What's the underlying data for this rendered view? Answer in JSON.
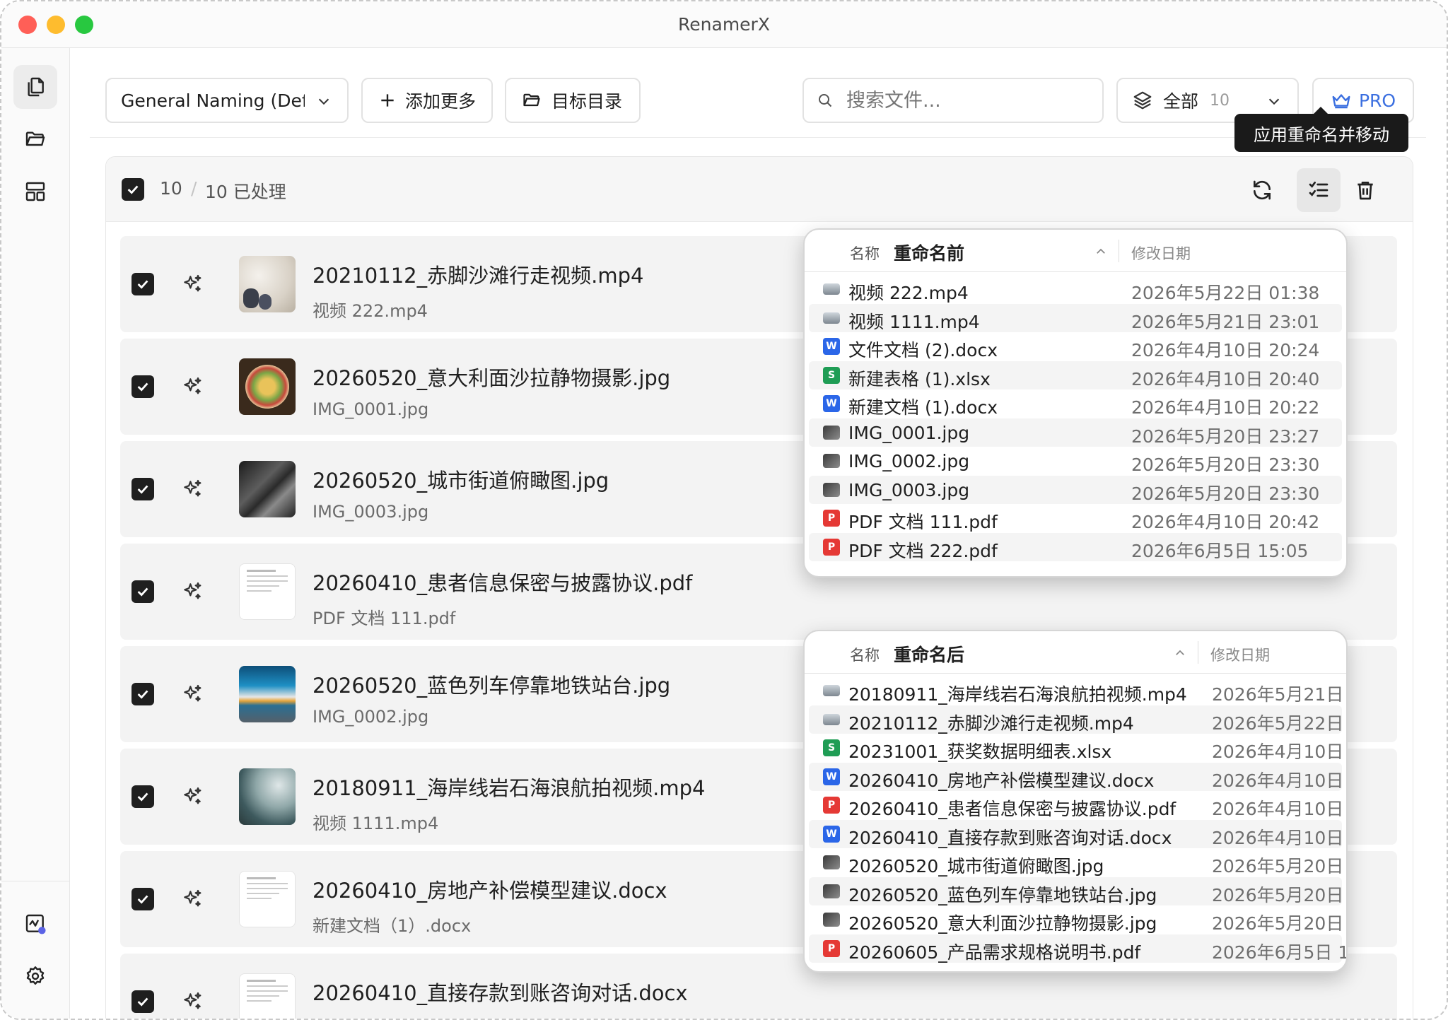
{
  "window": {
    "title": "RenamerX"
  },
  "colors": {
    "close": "#ff5f57",
    "minimize": "#febc2e",
    "maximize": "#28c840",
    "pro": "#3b6fe0",
    "word": "#2b66e8",
    "excel": "#1f9d55",
    "pdf": "#e53935"
  },
  "sidebar": {
    "items": [
      {
        "name": "copy-files-icon",
        "active": true
      },
      {
        "name": "folder-open-icon",
        "active": false
      },
      {
        "name": "layout-icon",
        "active": false
      }
    ],
    "bottom": [
      {
        "name": "activity-icon"
      },
      {
        "name": "settings-gear-icon"
      }
    ]
  },
  "toolbar": {
    "preset": "General Naming (Defa",
    "add_more": "添加更多",
    "target_dir": "目标目录",
    "search_placeholder": "搜索文件...",
    "filter_label": "全部",
    "filter_count": "10",
    "pro_label": "PRO"
  },
  "tooltip": "应用重命名并移动",
  "list": {
    "selected": "10",
    "separator": "/",
    "processed": "10 已处理",
    "rows": [
      {
        "name": "20210112_赤脚沙滩行走视频.mp4",
        "original": "视频 222.mp4",
        "thumb": "sand"
      },
      {
        "name": "20260520_意大利面沙拉静物摄影.jpg",
        "original": "IMG_0001.jpg",
        "thumb": "salad"
      },
      {
        "name": "20260520_城市街道俯瞰图.jpg",
        "original": "IMG_0003.jpg",
        "thumb": "city"
      },
      {
        "name": "20260410_患者信息保密与披露协议.pdf",
        "original": "PDF 文档 111.pdf",
        "thumb": "doc"
      },
      {
        "name": "20260520_蓝色列车停靠地铁站台.jpg",
        "original": "IMG_0002.jpg",
        "thumb": "train"
      },
      {
        "name": "20180911_海岸线岩石海浪航拍视频.mp4",
        "original": "视频 1111.mp4",
        "thumb": "coast"
      },
      {
        "name": "20260410_房地产补偿模型建议.docx",
        "original": "新建文档（1）.docx",
        "thumb": "doc"
      },
      {
        "name": "20260410_直接存款到账咨询对话.docx",
        "original": "",
        "thumb": "doc"
      }
    ]
  },
  "before_popup": {
    "col_name": "名称",
    "title": "重命名前",
    "col_date": "修改日期",
    "rows": [
      {
        "name": "视频 222.mp4",
        "date": "2026年5月22日 01:38",
        "type": "video"
      },
      {
        "name": "视频 1111.mp4",
        "date": "2026年5月21日 23:01",
        "type": "video"
      },
      {
        "name": "文件文档 (2).docx",
        "date": "2026年4月10日 20:24",
        "type": "word"
      },
      {
        "name": "新建表格 (1).xlsx",
        "date": "2026年4月10日 20:40",
        "type": "excel"
      },
      {
        "name": "新建文档 (1).docx",
        "date": "2026年4月10日 20:22",
        "type": "word"
      },
      {
        "name": "IMG_0001.jpg",
        "date": "2026年5月20日 23:27",
        "type": "image"
      },
      {
        "name": "IMG_0002.jpg",
        "date": "2026年5月20日 23:30",
        "type": "image"
      },
      {
        "name": "IMG_0003.jpg",
        "date": "2026年5月20日 23:30",
        "type": "image"
      },
      {
        "name": "PDF 文档 111.pdf",
        "date": "2026年4月10日 20:42",
        "type": "pdf"
      },
      {
        "name": "PDF 文档 222.pdf",
        "date": "2026年6月5日 15:05",
        "type": "pdf"
      }
    ]
  },
  "after_popup": {
    "col_name": "名称",
    "title": "重命名后",
    "col_date": "修改日期",
    "rows": [
      {
        "name": "20180911_海岸线岩石海浪航拍视频.mp4",
        "date": "2026年5月21日",
        "type": "video"
      },
      {
        "name": "20210112_赤脚沙滩行走视频.mp4",
        "date": "2026年5月22日",
        "type": "video"
      },
      {
        "name": "20231001_获奖数据明细表.xlsx",
        "date": "2026年4月10日",
        "type": "excel"
      },
      {
        "name": "20260410_房地产补偿模型建议.docx",
        "date": "2026年4月10日",
        "type": "word"
      },
      {
        "name": "20260410_患者信息保密与披露协议.pdf",
        "date": "2026年4月10日",
        "type": "pdf"
      },
      {
        "name": "20260410_直接存款到账咨询对话.docx",
        "date": "2026年4月10日",
        "type": "word"
      },
      {
        "name": "20260520_城市街道俯瞰图.jpg",
        "date": "2026年5月20日",
        "type": "image"
      },
      {
        "name": "20260520_蓝色列车停靠地铁站台.jpg",
        "date": "2026年5月20日",
        "type": "image"
      },
      {
        "name": "20260520_意大利面沙拉静物摄影.jpg",
        "date": "2026年5月20日",
        "type": "image"
      },
      {
        "name": "20260605_产品需求规格说明书.pdf",
        "date": "2026年6月5日 1",
        "type": "pdf"
      }
    ]
  }
}
